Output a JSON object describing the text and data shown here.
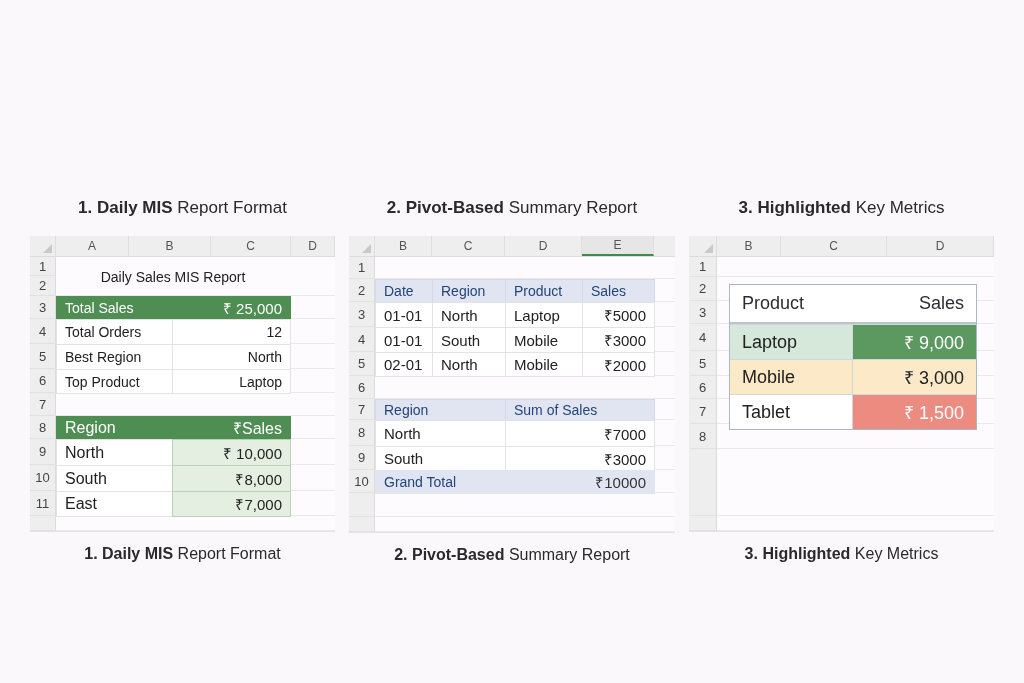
{
  "sheets": [
    {
      "kind": "mis",
      "title": "**1. Daily MIS** Report Format",
      "columns": [
        {
          "label": "A",
          "selected": false
        },
        {
          "label": "B",
          "selected": false
        },
        {
          "label": "C",
          "selected": false
        },
        {
          "label": "D",
          "selected": false
        }
      ],
      "row_numbers": [
        "1",
        "2",
        "3",
        "4",
        "5",
        "6",
        "7",
        "8",
        "9",
        "10",
        "11"
      ],
      "heading": "Daily Sales MIS Report",
      "summary": [
        {
          "label": "Total Sales",
          "value": "₹ 25,000",
          "highlighted": true
        },
        {
          "label": "Total Orders",
          "value": "12",
          "highlighted": false
        },
        {
          "label": "Best Region",
          "value": "North",
          "highlighted": false
        },
        {
          "label": "Top Product",
          "value": "Laptop",
          "highlighted": false
        }
      ],
      "region_table": {
        "headers": [
          "Region",
          "₹Sales"
        ],
        "rows": [
          {
            "region": "North",
            "sales": "₹ 10,000"
          },
          {
            "region": "South",
            "sales": "₹8,000"
          },
          {
            "region": "East",
            "sales": "₹7,000"
          }
        ]
      },
      "caption": "**1. Daily MIS** Report Format"
    },
    {
      "kind": "pivot",
      "title": "**2. Pivot-Based** Summary Report",
      "columns": [
        {
          "label": "B",
          "selected": false
        },
        {
          "label": "C",
          "selected": false
        },
        {
          "label": "D",
          "selected": false
        },
        {
          "label": "E",
          "selected": true
        }
      ],
      "row_numbers": [
        "1",
        "2",
        "3",
        "4",
        "5",
        "6",
        "7",
        "8",
        "9",
        "10"
      ],
      "source_table": {
        "headers": [
          "Date",
          "Region",
          "Product",
          "Sales"
        ],
        "rows": [
          [
            "01-01",
            "North",
            "Laptop",
            "₹5000"
          ],
          [
            "01-01",
            "South",
            "Mobile",
            "₹3000"
          ],
          [
            "02-01",
            "North",
            "Mobile",
            "₹2000"
          ]
        ]
      },
      "pivot_table": {
        "headers": [
          "Region",
          "Sum of Sales"
        ],
        "rows": [
          [
            "North",
            "₹7000"
          ],
          [
            "South",
            "₹3000"
          ]
        ],
        "total": [
          "Grand Total",
          "₹10000"
        ]
      },
      "caption": "**2. Pivot-Based** Summary Report"
    },
    {
      "kind": "highlight",
      "title": "**3. Highlighted** Key Metrics",
      "columns": [
        {
          "label": "B",
          "selected": false
        },
        {
          "label": "C",
          "selected": false
        },
        {
          "label": "D",
          "selected": false
        }
      ],
      "row_numbers": [
        "1",
        "2",
        "3",
        "4",
        "5",
        "6",
        "7",
        "8"
      ],
      "metrics_table": {
        "headers": [
          "Product",
          "Sales"
        ],
        "rows": [
          {
            "cells": [
              {
                "text": "Laptop",
                "color": "#d6e8d9"
              },
              {
                "text": "₹ 9,000",
                "color": "#5b9960"
              }
            ]
          },
          {
            "cells": [
              {
                "text": "Mobile",
                "color": "#fbe9c8"
              },
              {
                "text": "₹ 3,000",
                "color": "#fbe9c8"
              }
            ]
          },
          {
            "cells": [
              {
                "text": "Tablet",
                "color": "#ffffff"
              },
              {
                "text": "₹ 1,500",
                "color": "#ec8b80"
              }
            ]
          }
        ]
      },
      "caption": "**3. Highlighted** Key Metrics"
    }
  ]
}
